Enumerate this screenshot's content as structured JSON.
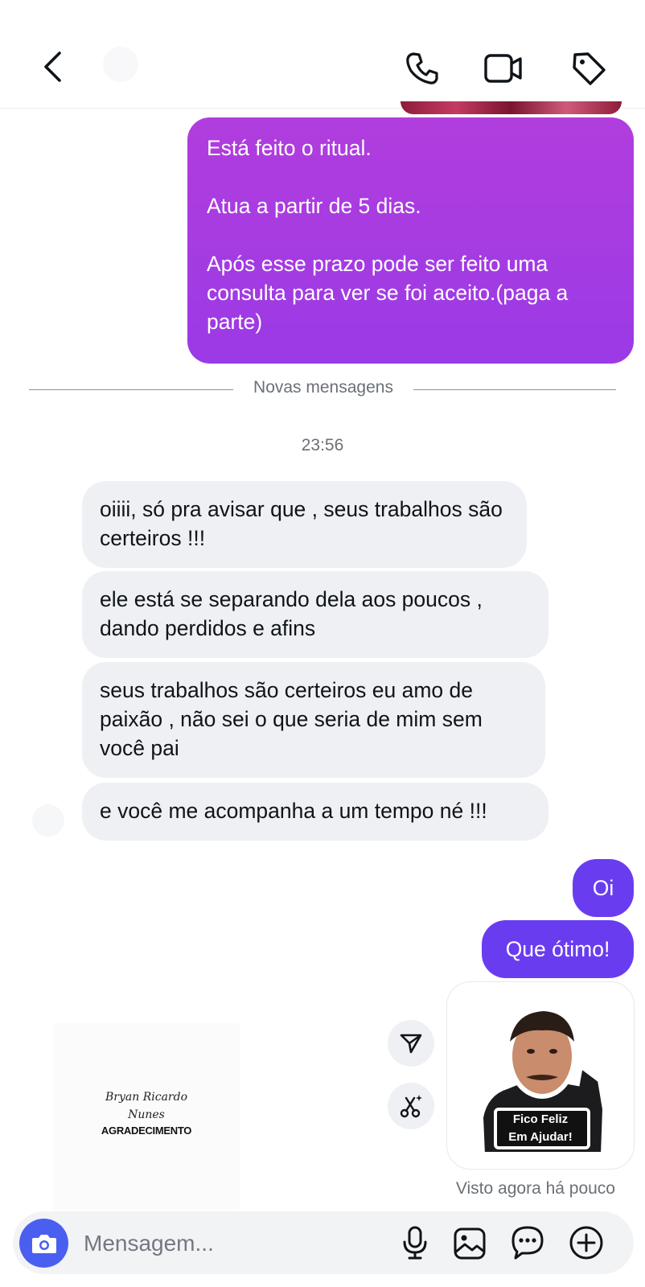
{
  "header": {
    "back_icon": "chevron-left-icon",
    "actions": [
      "phone-icon",
      "video-icon",
      "tag-icon"
    ]
  },
  "messages": {
    "sent_ritual": [
      "Está feito o ritual.",
      "Atua a partir de 5 dias.",
      "Após esse prazo pode ser feito uma consulta para ver se foi aceito.(paga a parte)"
    ],
    "divider": "Novas mensagens",
    "timestamp": "23:56",
    "received": [
      "oiiii, só pra avisar que , seus trabalhos são certeiros !!!",
      "ele está se separando dela aos poucos , dando perdidos e afins",
      "seus trabalhos são certeiros eu amo de paixão , não sei o que seria de mim sem você pai",
      "e você me acompanha a um tempo né !!!"
    ],
    "sent_oi": "Oi",
    "sent_otimo": "Que ótimo!",
    "sticker": {
      "line1": "Fico Feliz",
      "line2": "Em Ajudar!"
    },
    "left_card": {
      "line1": "Bryan Ricardo",
      "line2": "Nunes",
      "line3": "AGRADECIMENTO"
    },
    "seen": "Visto agora há pouco"
  },
  "composer": {
    "placeholder": "Mensagem...",
    "icons": [
      "camera-icon",
      "microphone-icon",
      "image-icon",
      "sticker-icon",
      "plus-icon"
    ]
  },
  "colors": {
    "gradient_top": "#b13ddd",
    "gradient_bottom": "#9b3ae6",
    "sent_bubble": "#6a3cf0",
    "received_bubble": "#eef0f3",
    "camera_button": "#4a5ff0"
  }
}
